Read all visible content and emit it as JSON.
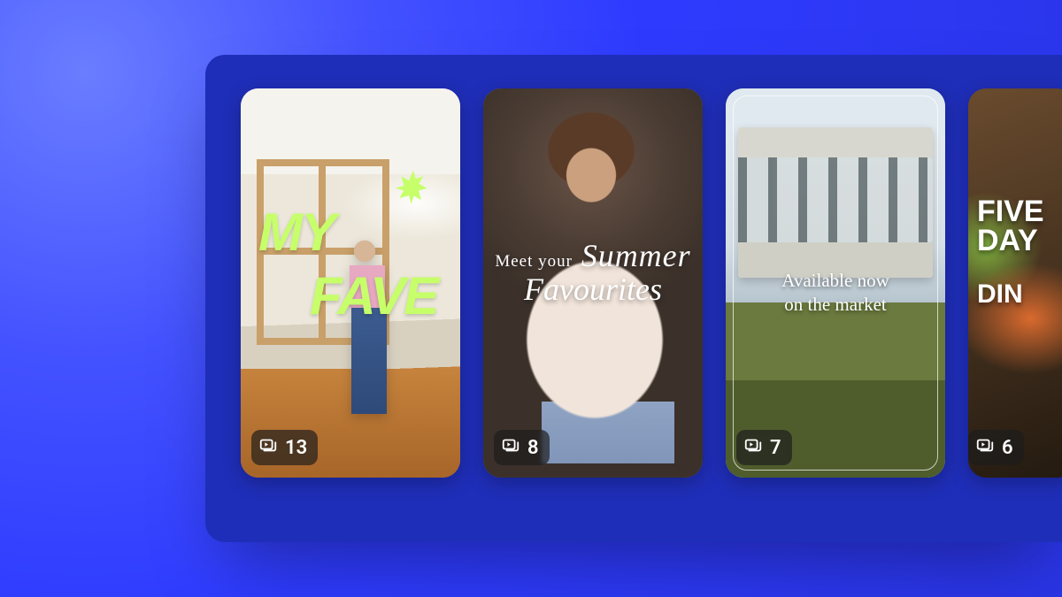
{
  "templates": [
    {
      "overlay_line1": "MY",
      "overlay_line2": "FAVE",
      "count": "13"
    },
    {
      "overlay_intro": "Meet your",
      "overlay_em": "Summer",
      "overlay_line2": "Favourites",
      "count": "8"
    },
    {
      "overlay_line1": "Available now",
      "overlay_line2": "on the market",
      "count": "7"
    },
    {
      "overlay_line1": "FIVE",
      "overlay_line2": "DAY",
      "overlay_line3": "DIN",
      "count": "6"
    }
  ]
}
